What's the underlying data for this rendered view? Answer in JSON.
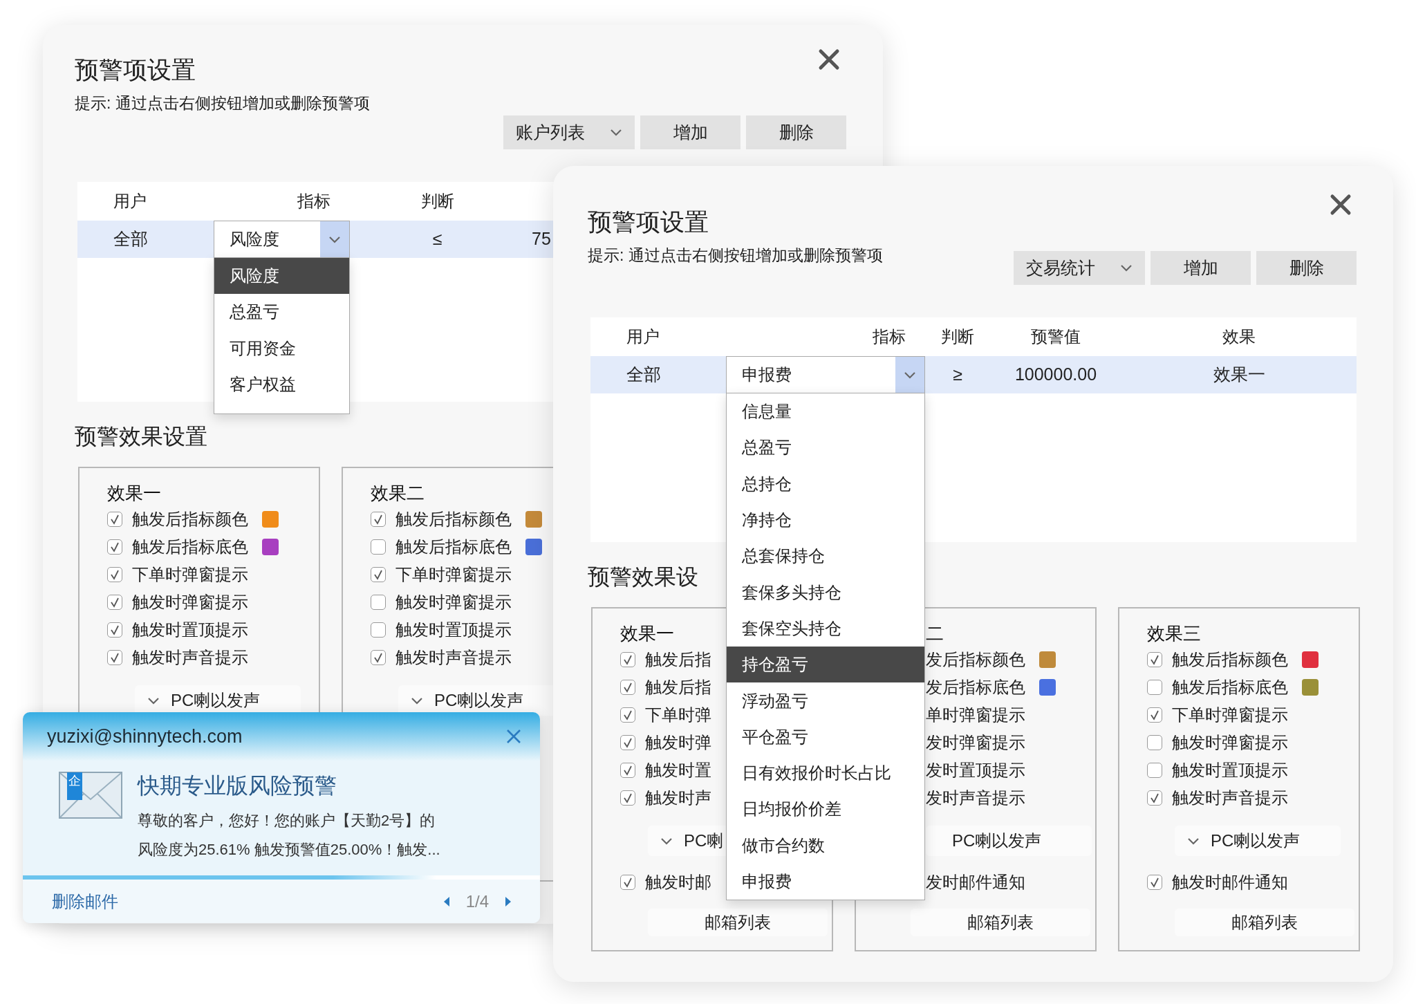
{
  "windows": [
    {
      "title": "预警项设置",
      "hint": "提示: 通过点击右侧按钮增加或删除预警项",
      "toolbar": {
        "select": "账户列表",
        "buttons": [
          "增加",
          "删除"
        ]
      },
      "columns": [
        "用户",
        "指标",
        "判断"
      ],
      "row": {
        "user": "全部",
        "indicator": "风险度",
        "operator": "≤",
        "threshold": "75"
      },
      "indicator_options": [
        {
          "label": "风险度",
          "selected": true
        },
        {
          "label": "总盈亏",
          "selected": false
        },
        {
          "label": "可用资金",
          "selected": false
        },
        {
          "label": "客户权益",
          "selected": false
        }
      ],
      "effects_title": "预警效果设置",
      "effects": [
        {
          "kind": "full",
          "title": "效果一",
          "options": [
            {
              "label": "触发后指标颜色",
              "checked": true,
              "color": "#f08c1a"
            },
            {
              "label": "触发后指标底色",
              "checked": true,
              "color": "#a83fc0"
            },
            {
              "label": "下单时弹窗提示",
              "checked": true
            },
            {
              "label": "触发时弹窗提示",
              "checked": true
            },
            {
              "label": "触发时置顶提示",
              "checked": true
            },
            {
              "label": "触发时声音提示",
              "checked": true
            }
          ],
          "sound_button": "PC喇以发声"
        },
        {
          "kind": "full",
          "title": "效果二",
          "options": [
            {
              "label": "触发后指标颜色",
              "checked": true,
              "color": "#c48a3a"
            },
            {
              "label": "触发后指标底色",
              "checked": false,
              "color": "#4a6fd8"
            },
            {
              "label": "下单时弹窗提示",
              "checked": true
            },
            {
              "label": "触发时弹窗提示",
              "checked": false
            },
            {
              "label": "触发时置顶提示",
              "checked": false
            },
            {
              "label": "触发时声音提示",
              "checked": true
            }
          ],
          "sound_button": "PC喇以发声"
        }
      ]
    },
    {
      "title": "预警项设置",
      "hint": "提示: 通过点击右侧按钮增加或删除预警项",
      "toolbar": {
        "select": "交易统计",
        "buttons": [
          "增加",
          "删除"
        ]
      },
      "columns": [
        "用户",
        "指标",
        "判断",
        "预警值",
        "效果"
      ],
      "row": {
        "user": "全部",
        "indicator": "申报费",
        "operator": "≥",
        "threshold": "100000.00",
        "effect": "效果一"
      },
      "indicator_options": [
        {
          "label": "信息量",
          "selected": false
        },
        {
          "label": "总盈亏",
          "selected": false
        },
        {
          "label": "总持仓",
          "selected": false
        },
        {
          "label": "净持仓",
          "selected": false
        },
        {
          "label": "总套保持仓",
          "selected": false
        },
        {
          "label": "套保多头持仓",
          "selected": false
        },
        {
          "label": "套保空头持仓",
          "selected": false
        },
        {
          "label": "持仓盈亏",
          "selected": true
        },
        {
          "label": "浮动盈亏",
          "selected": false
        },
        {
          "label": "平仓盈亏",
          "selected": false
        },
        {
          "label": "日有效报价时长占比",
          "selected": false
        },
        {
          "label": "日均报价价差",
          "selected": false
        },
        {
          "label": "做市合约数",
          "selected": false
        },
        {
          "label": "申报费",
          "selected": false
        }
      ],
      "effects_title": "预警效果设",
      "effects": [
        {
          "kind": "full",
          "title": "效果一",
          "options": [
            {
              "label": "触发后指",
              "checked": true
            },
            {
              "label": "触发后指",
              "checked": true
            },
            {
              "label": "下单时弹",
              "checked": true
            },
            {
              "label": "触发时弹",
              "checked": true
            },
            {
              "label": "触发时置",
              "checked": true
            },
            {
              "label": "触发时声",
              "checked": true
            }
          ],
          "sound_button": "PC喇",
          "mail_option": {
            "label": "触发时邮",
            "checked": true
          },
          "mailbox_button": "邮箱列表"
        },
        {
          "kind": "partial",
          "title": "二",
          "options": [
            {
              "label": "发后指标颜色",
              "color": "#bf8a3b"
            },
            {
              "label": "发后指标底色",
              "color": "#4a70e0"
            },
            {
              "label": "单时弹窗提示"
            },
            {
              "label": "发时弹窗提示"
            },
            {
              "label": "发时置顶提示"
            },
            {
              "label": "发时声音提示"
            }
          ],
          "sound_button": "PC喇以发声",
          "mail_option": {
            "label": "发时邮件通知"
          },
          "mailbox_button": "邮箱列表"
        },
        {
          "kind": "full",
          "title": "效果三",
          "options": [
            {
              "label": "触发后指标颜色",
              "checked": true,
              "color": "#e0303f"
            },
            {
              "label": "触发后指标底色",
              "checked": false,
              "color": "#9a9038"
            },
            {
              "label": "下单时弹窗提示",
              "checked": true
            },
            {
              "label": "触发时弹窗提示",
              "checked": false
            },
            {
              "label": "触发时置顶提示",
              "checked": false
            },
            {
              "label": "触发时声音提示",
              "checked": true
            }
          ],
          "sound_button": "PC喇以发声",
          "mail_option": {
            "label": "触发时邮件通知",
            "checked": true
          },
          "mailbox_button": "邮箱列表"
        }
      ]
    }
  ],
  "notification": {
    "email": "yuzixi@shinnytech.com",
    "badge": "企",
    "title": "快期专业版风险预警",
    "message": [
      "尊敬的客户，您好！您的账户【天勤2号】的",
      "风险度为25.61% 触发预警值25.00%！触发..."
    ],
    "progress": {
      "level": 0.8
    },
    "delete_link": "删除邮件",
    "pager": "1/4"
  }
}
